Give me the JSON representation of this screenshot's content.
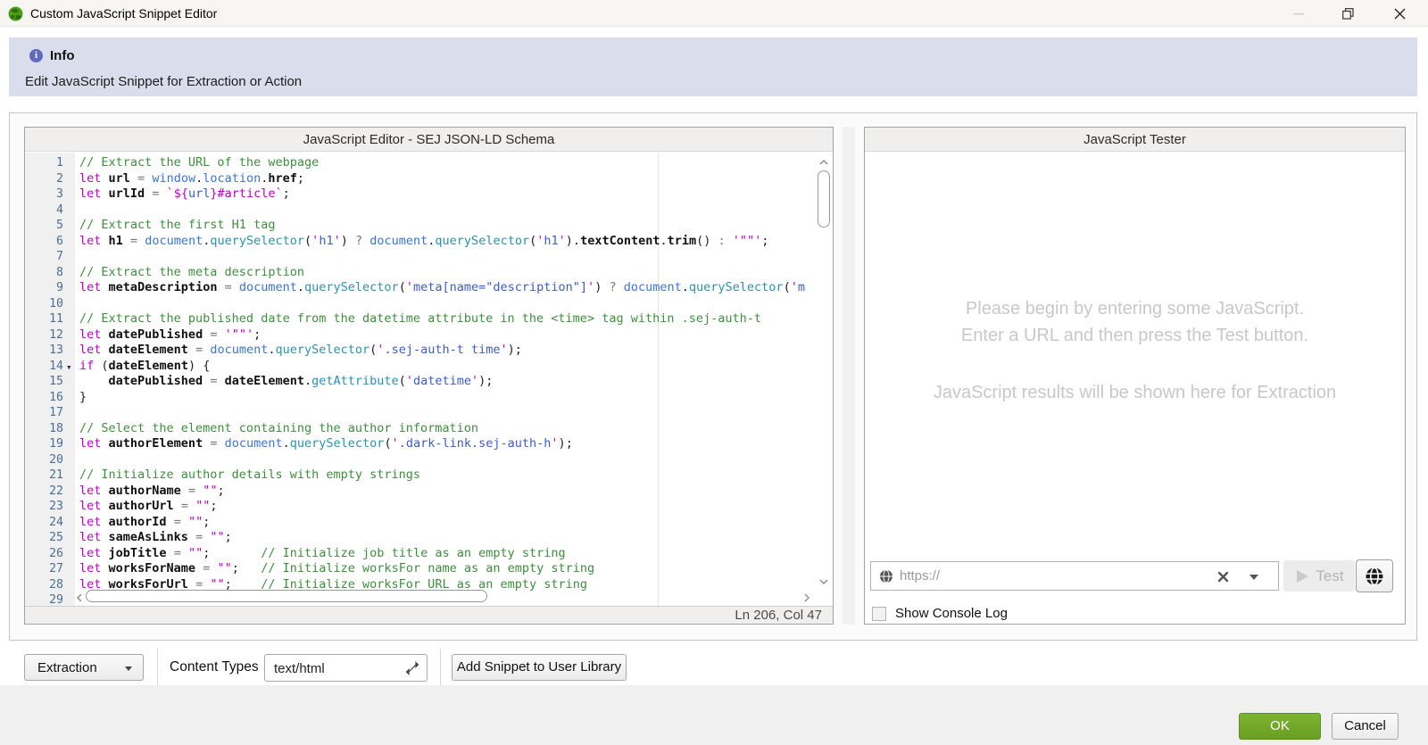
{
  "titlebar": {
    "title": "Custom JavaScript Snippet Editor"
  },
  "banner": {
    "title": "Info",
    "subtitle": "Edit JavaScript Snippet for Extraction or Action"
  },
  "editor": {
    "header": "JavaScript Editor - SEJ JSON-LD Schema",
    "status": "Ln 206, Col 47",
    "fold_line": 14,
    "lines": [
      [
        [
          "cm",
          "// Extract the URL of the webpage"
        ]
      ],
      [
        [
          "kw",
          "let"
        ],
        [
          "tx",
          " "
        ],
        [
          "vr",
          "url"
        ],
        [
          "op",
          " = "
        ],
        [
          "ob",
          "window"
        ],
        [
          "pu",
          "."
        ],
        [
          "ob",
          "location"
        ],
        [
          "pu",
          "."
        ],
        [
          "pr",
          "href"
        ],
        [
          "pu",
          ";"
        ]
      ],
      [
        [
          "kw",
          "let"
        ],
        [
          "tx",
          " "
        ],
        [
          "vr",
          "urlId"
        ],
        [
          "op",
          " = "
        ],
        [
          "sq",
          "`${"
        ],
        [
          "st",
          "url"
        ],
        [
          "sq",
          "}#article`"
        ],
        [
          "pu",
          ";"
        ]
      ],
      [],
      [
        [
          "cm",
          "// Extract the first H1 tag"
        ]
      ],
      [
        [
          "kw",
          "let"
        ],
        [
          "tx",
          " "
        ],
        [
          "vr",
          "h1"
        ],
        [
          "op",
          " = "
        ],
        [
          "ob",
          "document"
        ],
        [
          "pu",
          "."
        ],
        [
          "mt",
          "querySelector"
        ],
        [
          "pu",
          "("
        ],
        [
          "sq",
          "'"
        ],
        [
          "st",
          "h1"
        ],
        [
          "sq",
          "'"
        ],
        [
          "pu",
          ")"
        ],
        [
          "op",
          " ? "
        ],
        [
          "ob",
          "document"
        ],
        [
          "pu",
          "."
        ],
        [
          "mt",
          "querySelector"
        ],
        [
          "pu",
          "("
        ],
        [
          "sq",
          "'"
        ],
        [
          "st",
          "h1"
        ],
        [
          "sq",
          "'"
        ],
        [
          "pu",
          ")"
        ],
        [
          "pu",
          "."
        ],
        [
          "pr",
          "textContent"
        ],
        [
          "pu",
          "."
        ],
        [
          "pr",
          "trim"
        ],
        [
          "pu",
          "()"
        ],
        [
          "op",
          " : "
        ],
        [
          "sq",
          "'\"\"'"
        ],
        [
          "pu",
          ";"
        ]
      ],
      [],
      [
        [
          "cm",
          "// Extract the meta description"
        ]
      ],
      [
        [
          "kw",
          "let"
        ],
        [
          "tx",
          " "
        ],
        [
          "vr",
          "metaDescription"
        ],
        [
          "op",
          " = "
        ],
        [
          "ob",
          "document"
        ],
        [
          "pu",
          "."
        ],
        [
          "mt",
          "querySelector"
        ],
        [
          "pu",
          "("
        ],
        [
          "sq",
          "'"
        ],
        [
          "st",
          "meta[name=\"description\"]"
        ],
        [
          "sq",
          "'"
        ],
        [
          "pu",
          ")"
        ],
        [
          "op",
          " ? "
        ],
        [
          "ob",
          "document"
        ],
        [
          "pu",
          "."
        ],
        [
          "mt",
          "querySelector"
        ],
        [
          "pu",
          "("
        ],
        [
          "sq",
          "'"
        ],
        [
          "st",
          "m"
        ]
      ],
      [],
      [
        [
          "cm",
          "// Extract the published date from the datetime attribute in the <time> tag within .sej-auth-t"
        ]
      ],
      [
        [
          "kw",
          "let"
        ],
        [
          "tx",
          " "
        ],
        [
          "vr",
          "datePublished"
        ],
        [
          "op",
          " = "
        ],
        [
          "sq",
          "'\"\"'"
        ],
        [
          "pu",
          ";"
        ]
      ],
      [
        [
          "kw",
          "let"
        ],
        [
          "tx",
          " "
        ],
        [
          "vr",
          "dateElement"
        ],
        [
          "op",
          " = "
        ],
        [
          "ob",
          "document"
        ],
        [
          "pu",
          "."
        ],
        [
          "mt",
          "querySelector"
        ],
        [
          "pu",
          "("
        ],
        [
          "sq",
          "'"
        ],
        [
          "st",
          ".sej-auth-t time"
        ],
        [
          "sq",
          "'"
        ],
        [
          "pu",
          ")"
        ],
        [
          "pu",
          ";"
        ]
      ],
      [
        [
          "kw",
          "if"
        ],
        [
          "tx",
          " "
        ],
        [
          "pu",
          "("
        ],
        [
          "vr",
          "dateElement"
        ],
        [
          "pu",
          ") {"
        ]
      ],
      [
        [
          "tx",
          "    "
        ],
        [
          "vr",
          "datePublished"
        ],
        [
          "op",
          " = "
        ],
        [
          "vr",
          "dateElement"
        ],
        [
          "pu",
          "."
        ],
        [
          "mt",
          "getAttribute"
        ],
        [
          "pu",
          "("
        ],
        [
          "sq",
          "'"
        ],
        [
          "st",
          "datetime"
        ],
        [
          "sq",
          "'"
        ],
        [
          "pu",
          ")"
        ],
        [
          "pu",
          ";"
        ]
      ],
      [
        [
          "pu",
          "}"
        ]
      ],
      [],
      [
        [
          "cm",
          "// Select the element containing the author information"
        ]
      ],
      [
        [
          "kw",
          "let"
        ],
        [
          "tx",
          " "
        ],
        [
          "vr",
          "authorElement"
        ],
        [
          "op",
          " = "
        ],
        [
          "ob",
          "document"
        ],
        [
          "pu",
          "."
        ],
        [
          "mt",
          "querySelector"
        ],
        [
          "pu",
          "("
        ],
        [
          "sq",
          "'"
        ],
        [
          "st",
          ".dark-link.sej-auth-h"
        ],
        [
          "sq",
          "'"
        ],
        [
          "pu",
          ")"
        ],
        [
          "pu",
          ";"
        ]
      ],
      [],
      [
        [
          "cm",
          "// Initialize author details with empty strings"
        ]
      ],
      [
        [
          "kw",
          "let"
        ],
        [
          "tx",
          " "
        ],
        [
          "vr",
          "authorName"
        ],
        [
          "op",
          " = "
        ],
        [
          "sq",
          "\"\""
        ],
        [
          "pu",
          ";"
        ]
      ],
      [
        [
          "kw",
          "let"
        ],
        [
          "tx",
          " "
        ],
        [
          "vr",
          "authorUrl"
        ],
        [
          "op",
          " = "
        ],
        [
          "sq",
          "\"\""
        ],
        [
          "pu",
          ";"
        ]
      ],
      [
        [
          "kw",
          "let"
        ],
        [
          "tx",
          " "
        ],
        [
          "vr",
          "authorId"
        ],
        [
          "op",
          " = "
        ],
        [
          "sq",
          "\"\""
        ],
        [
          "pu",
          ";"
        ]
      ],
      [
        [
          "kw",
          "let"
        ],
        [
          "tx",
          " "
        ],
        [
          "vr",
          "sameAsLinks"
        ],
        [
          "op",
          " = "
        ],
        [
          "sq",
          "\"\""
        ],
        [
          "pu",
          ";"
        ]
      ],
      [
        [
          "kw",
          "let"
        ],
        [
          "tx",
          " "
        ],
        [
          "vr",
          "jobTitle"
        ],
        [
          "op",
          " = "
        ],
        [
          "sq",
          "\"\""
        ],
        [
          "pu",
          ";"
        ],
        [
          "tx",
          "       "
        ],
        [
          "cm",
          "// Initialize job title as an empty string"
        ]
      ],
      [
        [
          "kw",
          "let"
        ],
        [
          "tx",
          " "
        ],
        [
          "vr",
          "worksForName"
        ],
        [
          "op",
          " = "
        ],
        [
          "sq",
          "\"\""
        ],
        [
          "pu",
          ";"
        ],
        [
          "tx",
          "   "
        ],
        [
          "cm",
          "// Initialize worksFor name as an empty string"
        ]
      ],
      [
        [
          "kw",
          "let"
        ],
        [
          "tx",
          " "
        ],
        [
          "vr",
          "worksForUrl"
        ],
        [
          "op",
          " = "
        ],
        [
          "sq",
          "\"\""
        ],
        [
          "pu",
          ";"
        ],
        [
          "tx",
          "    "
        ],
        [
          "cm",
          "// Initialize worksFor URL as an empty string"
        ]
      ],
      []
    ]
  },
  "tester": {
    "header": "JavaScript Tester",
    "placeholder_line1": "Please begin by entering some JavaScript.",
    "placeholder_line2": "Enter a URL and then press the Test button.",
    "placeholder_line3": "JavaScript results will be shown here for Extraction",
    "url_placeholder": "https://",
    "test_label": "Test",
    "console_label": "Show Console Log"
  },
  "toolbar": {
    "mode_value": "Extraction",
    "content_types_label": "Content Types",
    "content_types_value": "text/html",
    "add_snippet_label": "Add Snippet to User Library"
  },
  "footer": {
    "ok": "OK",
    "cancel": "Cancel"
  },
  "colors": {
    "ok_green": "#71a62b",
    "banner_bg": "#d9ddec",
    "accent_blue": "#3a74d8"
  }
}
